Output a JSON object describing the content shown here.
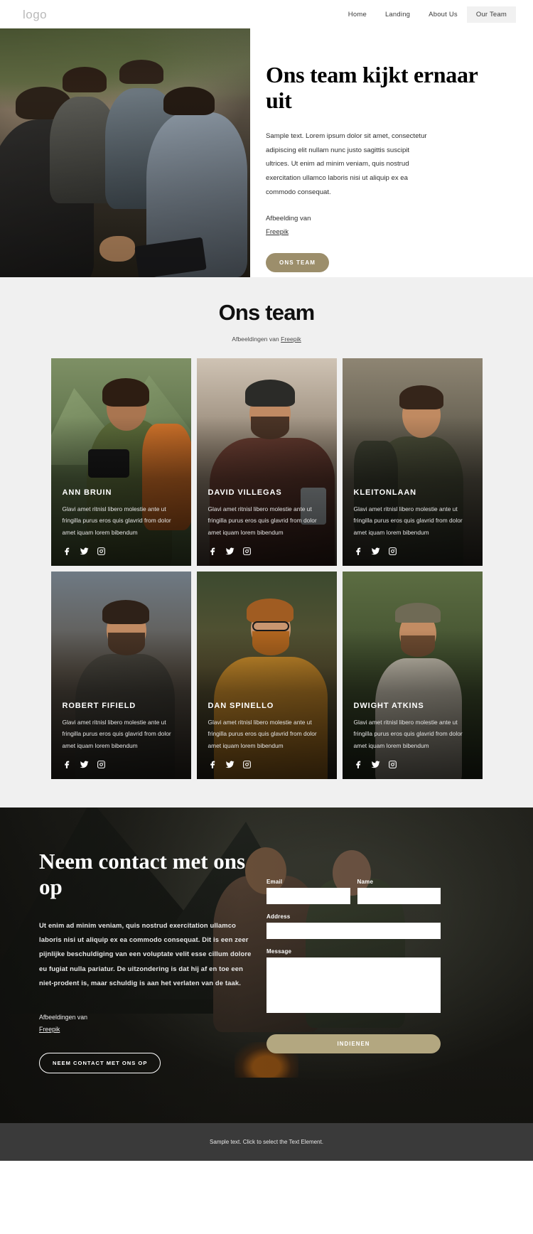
{
  "header": {
    "logo": "logo",
    "nav": [
      {
        "label": "Home",
        "active": false
      },
      {
        "label": "Landing",
        "active": false
      },
      {
        "label": "About Us",
        "active": false
      },
      {
        "label": "Our Team",
        "active": true
      }
    ]
  },
  "hero": {
    "title": "Ons team kijkt ernaar uit",
    "body": "Sample text. Lorem ipsum dolor sit amet, consectetur adipiscing elit nullam nunc justo sagittis suscipit ultrices. Ut enim ad minim veniam, quis nostrud exercitation ullamco laboris nisi ut aliquip ex ea commodo consequat.",
    "credit_label": "Afbeelding van",
    "credit_link": "Freepik",
    "cta": "ONS TEAM"
  },
  "team": {
    "title": "Ons team",
    "subtitle_prefix": "Afbeeldingen van ",
    "subtitle_link": "Freepik",
    "members": [
      {
        "name": "ANN BRUIN",
        "desc": "Glavi amet ritnisl libero molestie ante ut fringilla purus eros quis glavrid from dolor amet iquam lorem bibendum"
      },
      {
        "name": "DAVID VILLEGAS",
        "desc": "Glavi amet ritnisl libero molestie ante ut fringilla purus eros quis glavrid from dolor amet iquam lorem bibendum"
      },
      {
        "name": "KLEITONLAAN",
        "desc": "Glavi amet ritnisl libero molestie ante ut fringilla purus eros quis glavrid from dolor amet iquam lorem bibendum"
      },
      {
        "name": "ROBERT FIFIELD",
        "desc": "Glavi amet ritnisl libero molestie ante ut fringilla purus eros quis glavrid from dolor amet iquam lorem bibendum"
      },
      {
        "name": "DAN SPINELLO",
        "desc": "Glavi amet ritnisl libero molestie ante ut fringilla purus eros quis glavrid from dolor amet iquam lorem bibendum"
      },
      {
        "name": "DWIGHT ATKINS",
        "desc": "Glavi amet ritnisl libero molestie ante ut fringilla purus eros quis glavrid from dolor amet iquam lorem bibendum"
      }
    ],
    "social_icons": [
      "facebook-icon",
      "twitter-icon",
      "instagram-icon"
    ]
  },
  "contact": {
    "title": "Neem contact met ons op",
    "body": "Ut enim ad minim veniam, quis nostrud exercitation ullamco laboris nisi ut aliquip ex ea commodo consequat. Dit is een zeer pijnlijke beschuldiging van een voluptate velit esse cillum dolore eu fugiat nulla pariatur. De uitzondering is dat hij af en toe een niet-prodent is, maar schuldig is aan het verlaten van de taak.",
    "credit_label": "Afbeeldingen van",
    "credit_link": "Freepik",
    "cta": "NEEM CONTACT MET ONS OP",
    "form": {
      "email_label": "Email",
      "email_value": "",
      "name_label": "Name",
      "name_value": "",
      "address_label": "Address",
      "address_value": "",
      "message_label": "Message",
      "message_value": "",
      "submit": "INDIENEN"
    }
  },
  "footer": {
    "text": "Sample text. Click to select the Text Element."
  },
  "colors": {
    "accent": "#9c8e6b",
    "submit": "#b3a780",
    "team_bg": "#f0f0f0",
    "footer_bg": "#3a3a3a"
  }
}
